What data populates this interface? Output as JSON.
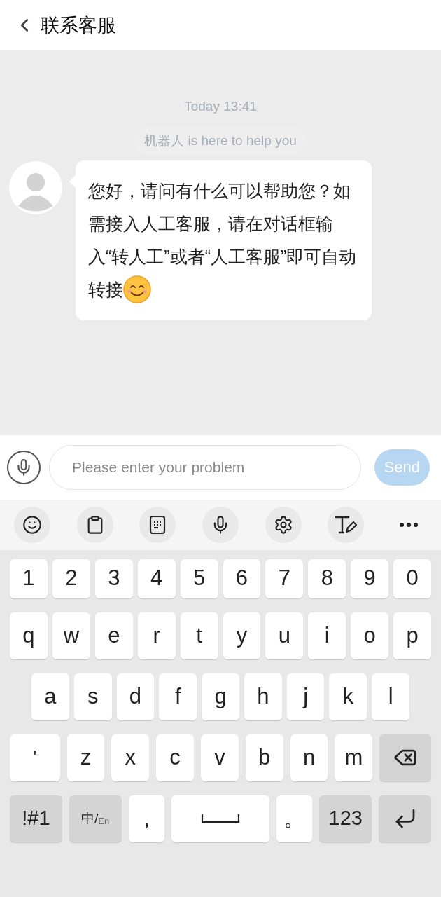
{
  "header": {
    "title": "联系客服"
  },
  "chat": {
    "timestamp": "Today 13:41",
    "notice": "机器人 is here to help you",
    "messages": [
      {
        "text": "您好，请问有什么可以帮助您？如需接入人工客服，请在对话框输入“转人工”或者“人工客服”即可自动转接",
        "emoji": true
      }
    ]
  },
  "composer": {
    "placeholder": "Please enter your problem",
    "send": {
      "label": "Send",
      "disabled": true
    }
  },
  "keyboard": {
    "rows": [
      {
        "keys": [
          {
            "kind": "digit",
            "label": "1"
          },
          {
            "kind": "digit",
            "label": "2"
          },
          {
            "kind": "digit",
            "label": "3"
          },
          {
            "kind": "digit",
            "label": "4"
          },
          {
            "kind": "digit",
            "label": "5"
          },
          {
            "kind": "digit",
            "label": "6"
          },
          {
            "kind": "digit",
            "label": "7"
          },
          {
            "kind": "digit",
            "label": "8"
          },
          {
            "kind": "digit",
            "label": "9"
          },
          {
            "kind": "digit",
            "label": "0"
          }
        ]
      },
      {
        "keys": [
          {
            "kind": "char",
            "label": "q"
          },
          {
            "kind": "char",
            "label": "w"
          },
          {
            "kind": "char",
            "label": "e"
          },
          {
            "kind": "char",
            "label": "r"
          },
          {
            "kind": "char",
            "label": "t"
          },
          {
            "kind": "char",
            "label": "y"
          },
          {
            "kind": "char",
            "label": "u"
          },
          {
            "kind": "char",
            "label": "i"
          },
          {
            "kind": "char",
            "label": "o"
          },
          {
            "kind": "char",
            "label": "p"
          }
        ]
      },
      {
        "keys": [
          {
            "kind": "char",
            "label": "a"
          },
          {
            "kind": "char",
            "label": "s"
          },
          {
            "kind": "char",
            "label": "d"
          },
          {
            "kind": "char",
            "label": "f"
          },
          {
            "kind": "char",
            "label": "g"
          },
          {
            "kind": "char",
            "label": "h"
          },
          {
            "kind": "char",
            "label": "j"
          },
          {
            "kind": "char",
            "label": "k"
          },
          {
            "kind": "char",
            "label": "l"
          }
        ]
      },
      {
        "keys": [
          {
            "kind": "wide",
            "label": "'"
          },
          {
            "kind": "char",
            "label": "z"
          },
          {
            "kind": "char",
            "label": "x"
          },
          {
            "kind": "char",
            "label": "c"
          },
          {
            "kind": "char",
            "label": "v"
          },
          {
            "kind": "char",
            "label": "b"
          },
          {
            "kind": "char",
            "label": "n"
          },
          {
            "kind": "char",
            "label": "m"
          },
          {
            "kind": "backspace"
          }
        ]
      },
      {
        "keys": [
          {
            "kind": "function",
            "label": "!#1"
          },
          {
            "kind": "lang",
            "label": "中/",
            "sub": "En"
          },
          {
            "kind": "char",
            "label": ","
          },
          {
            "kind": "space"
          },
          {
            "kind": "char",
            "label": "。"
          },
          {
            "kind": "function",
            "label": "123"
          },
          {
            "kind": "enter"
          }
        ]
      }
    ]
  }
}
